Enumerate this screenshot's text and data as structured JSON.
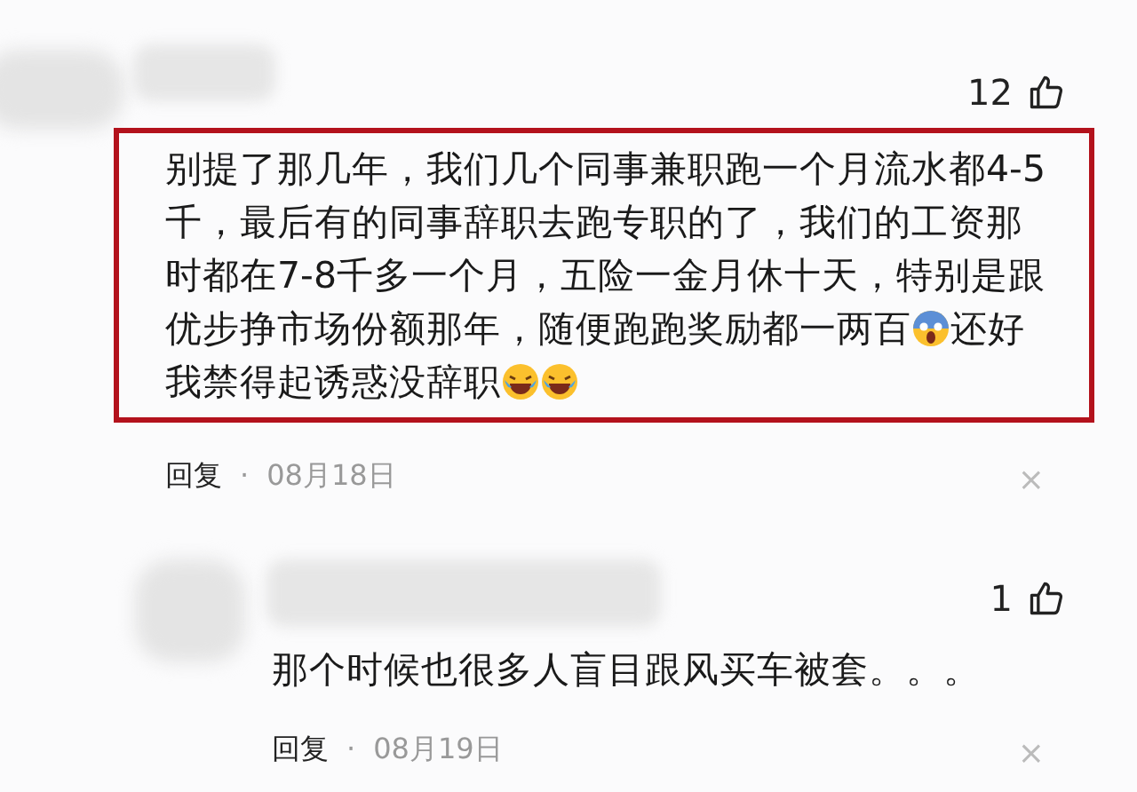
{
  "comments": [
    {
      "likes": "12",
      "highlighted": true,
      "body": [
        {
          "kind": "text",
          "text": "别提了那几年，我们几个同事兼职跑一个月流水都4-5千，最后有的同事辞职去跑专职的了，我们的工资那时都在7-8千多一个月，五险一金月休十天，特别是跟优步挣市场份额那年，随便跑跑奖励都一两百"
        },
        {
          "kind": "scream"
        },
        {
          "kind": "text",
          "text": "还好我禁得起诱惑没辞职"
        },
        {
          "kind": "laugh"
        },
        {
          "kind": "laugh"
        }
      ],
      "reply": "回复",
      "separator": "·",
      "date": "08月18日",
      "close": "×"
    },
    {
      "likes": "1",
      "highlighted": false,
      "body": [
        {
          "kind": "text",
          "text": "那个时候也很多人盲目跟风买车被套。。。"
        }
      ],
      "reply": "回复",
      "separator": "·",
      "date": "08月19日",
      "close": "×"
    }
  ]
}
